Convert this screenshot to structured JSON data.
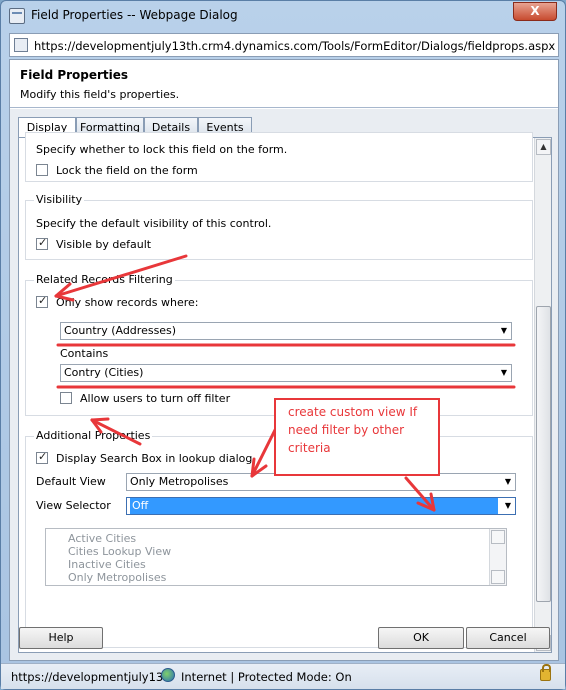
{
  "window": {
    "title": "Field Properties -- Webpage Dialog",
    "close_label": "X",
    "url": "https://developmentjuly13th.crm4.dynamics.com/Tools/FormEditor/Dialogs/fieldprops.aspx?ap"
  },
  "header": {
    "title": "Field Properties",
    "subtitle": "Modify this field's properties."
  },
  "tabs": [
    {
      "label": "Display",
      "active": true
    },
    {
      "label": "Formatting",
      "active": false
    },
    {
      "label": "Details",
      "active": false
    },
    {
      "label": "Events",
      "active": false
    }
  ],
  "lock": {
    "description": "Specify whether to lock this field on the form.",
    "checkbox_label": "Lock the field on the form",
    "checked": false
  },
  "visibility": {
    "title": "Visibility",
    "description": "Specify the default visibility of this control.",
    "checkbox_label": "Visible by default",
    "checked": true
  },
  "related_filtering": {
    "title": "Related Records Filtering",
    "only_show_label": "Only show records where:",
    "only_show_checked": true,
    "first_select": "Country (Addresses)",
    "contains_label": "Contains",
    "second_select": "Contry (Cities)",
    "allow_off_label": "Allow users to turn off filter",
    "allow_off_checked": false
  },
  "additional": {
    "title": "Additional Properties",
    "search_box_label": "Display Search Box in lookup dialog",
    "search_box_checked": true,
    "default_view_label": "Default View",
    "default_view_value": "Only Metropolises",
    "view_selector_label": "View Selector",
    "view_selector_value": "Off",
    "views": [
      "Active Cities",
      "Cities Lookup View",
      "Inactive Cities",
      "Only Metropolises"
    ]
  },
  "annotation": {
    "note": "create custom view If need filter by other criteria",
    "color": "#e8373a"
  },
  "buttons": {
    "help": "Help",
    "ok": "OK",
    "cancel": "Cancel"
  },
  "status_bar": {
    "url": "https://developmentjuly13t",
    "zone": "Internet | Protected Mode: On"
  }
}
